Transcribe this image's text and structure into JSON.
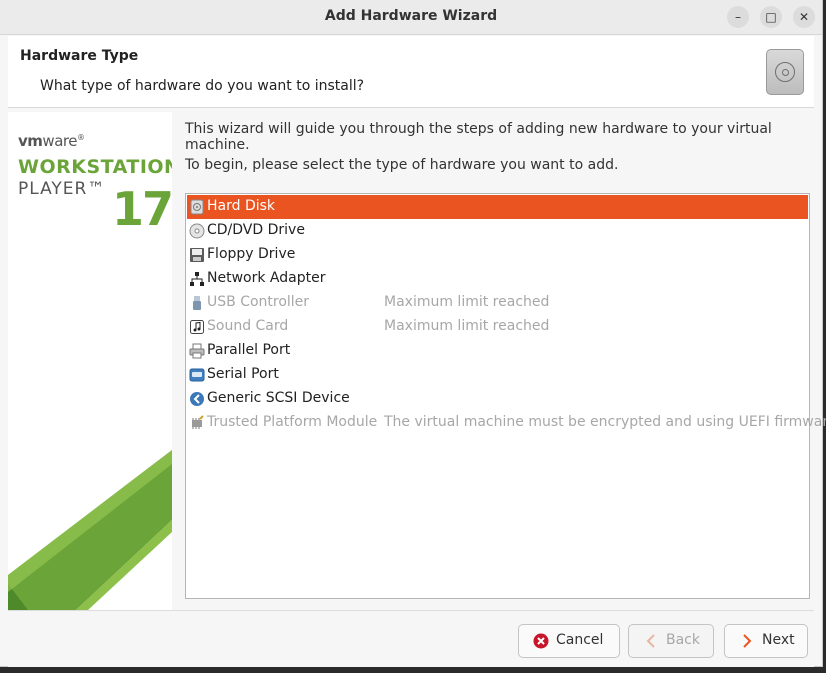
{
  "window": {
    "title": "Add Hardware Wizard",
    "controls": {
      "minimize": "–",
      "maximize": "□",
      "close": "✕"
    }
  },
  "header": {
    "title": "Hardware Type",
    "subtitle": "What type of hardware do you want to install?",
    "icon": "cd-drive-icon"
  },
  "branding": {
    "vendor_bold": "vm",
    "vendor_regular": "ware",
    "vendor_mark": "®",
    "product": "WORKSTATION",
    "edition": "PLAYER™",
    "version": "17",
    "accent_color": "#6ba539"
  },
  "content": {
    "intro": "This wizard will guide you through the steps of adding new hardware to your virtual machine.",
    "prompt": "To begin, please select the type of hardware you want to add."
  },
  "hardware_list": [
    {
      "label": "Hard Disk",
      "note": "",
      "icon": "hard-disk-icon",
      "state": "selected"
    },
    {
      "label": "CD/DVD Drive",
      "note": "",
      "icon": "cd-dvd-icon",
      "state": "enabled"
    },
    {
      "label": "Floppy Drive",
      "note": "",
      "icon": "floppy-icon",
      "state": "enabled"
    },
    {
      "label": "Network Adapter",
      "note": "",
      "icon": "network-icon",
      "state": "enabled"
    },
    {
      "label": "USB Controller",
      "note": "Maximum limit reached",
      "icon": "usb-icon",
      "state": "disabled"
    },
    {
      "label": "Sound Card",
      "note": "Maximum limit reached",
      "icon": "sound-card-icon",
      "state": "disabled"
    },
    {
      "label": "Parallel Port",
      "note": "",
      "icon": "printer-icon",
      "state": "enabled"
    },
    {
      "label": "Serial Port",
      "note": "",
      "icon": "serial-port-icon",
      "state": "enabled"
    },
    {
      "label": "Generic SCSI Device",
      "note": "",
      "icon": "scsi-icon",
      "state": "enabled"
    },
    {
      "label": "Trusted Platform Module",
      "note": "The virtual machine must be encrypted and using UEFI firmware.",
      "icon": "tpm-chip-icon",
      "state": "disabled"
    }
  ],
  "buttons": {
    "cancel": "Cancel",
    "back": "Back",
    "next": "Next"
  },
  "colors": {
    "selection": "#e95420",
    "cancel_icon": "#c7162b"
  }
}
